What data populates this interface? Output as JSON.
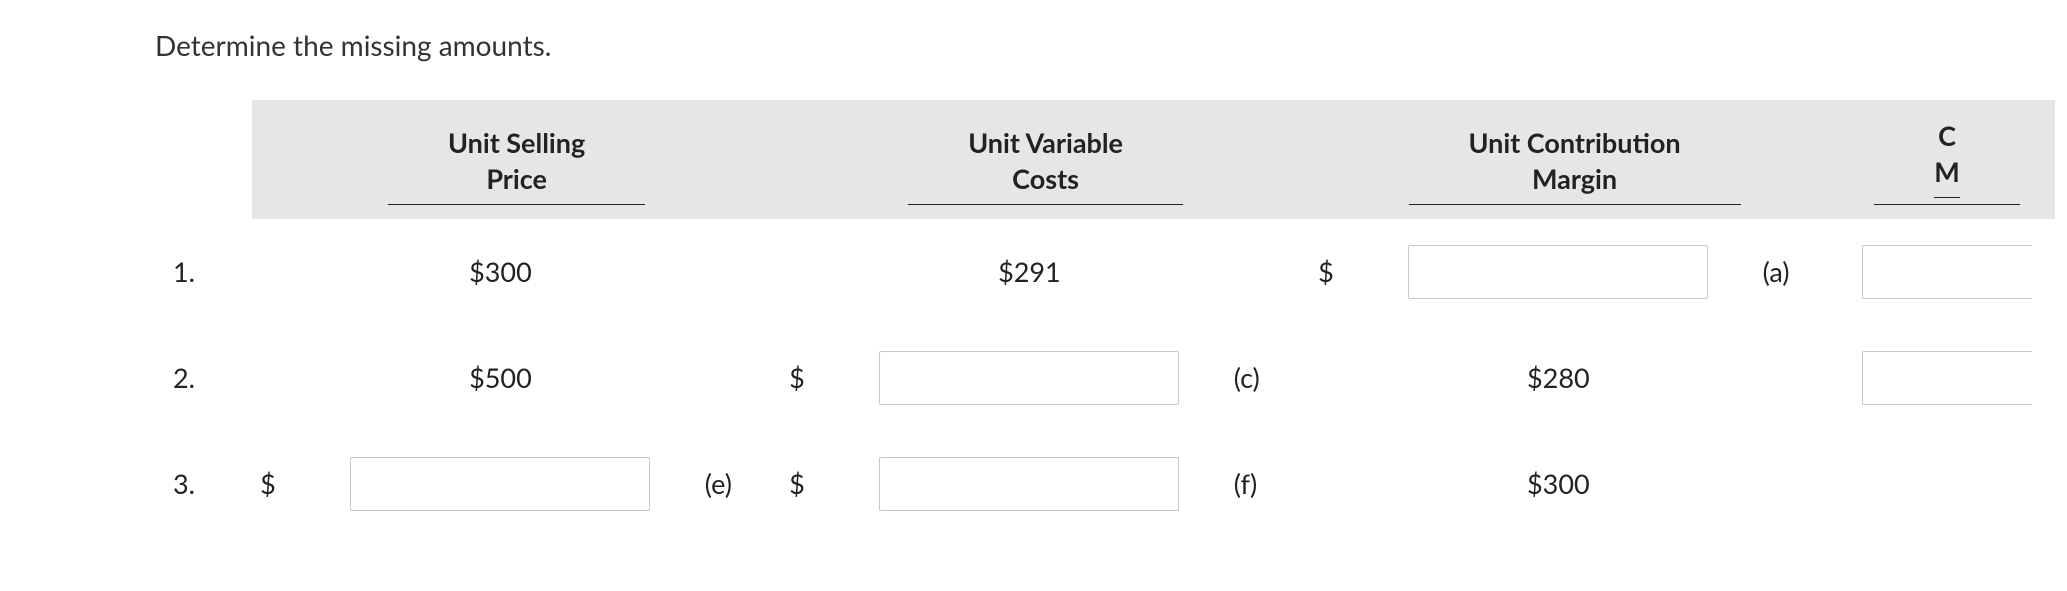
{
  "instruction": "Determine the missing amounts.",
  "headers": {
    "price": "Unit Selling\nPrice",
    "variable": "Unit Variable\nCosts",
    "contribution": "Unit Contribution\nMargin",
    "last_partial": "C\nM"
  },
  "currency": "$",
  "rows": [
    {
      "num": "1.",
      "price": {
        "text": "$300"
      },
      "variable": {
        "text": "$291"
      },
      "contribution": {
        "input": true,
        "prefix": "$",
        "label": "(a)",
        "value": ""
      },
      "last": {
        "input": true,
        "value": ""
      }
    },
    {
      "num": "2.",
      "price": {
        "text": "$500"
      },
      "variable": {
        "input": true,
        "prefix": "$",
        "label": "(c)",
        "value": ""
      },
      "contribution": {
        "text": "$280"
      },
      "last": {
        "input": true,
        "value": ""
      }
    },
    {
      "num": "3.",
      "price": {
        "input": true,
        "prefix": "$",
        "label": "(e)",
        "value": ""
      },
      "variable": {
        "input": true,
        "prefix": "$",
        "label": "(f)",
        "value": ""
      },
      "contribution": {
        "text": "$300"
      },
      "last": null
    }
  ]
}
